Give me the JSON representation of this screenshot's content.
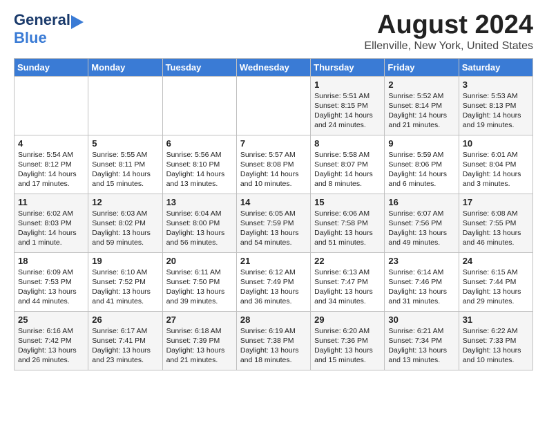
{
  "header": {
    "logo": {
      "line1": "General",
      "line2": "Blue"
    },
    "title": "August 2024",
    "location": "Ellenville, New York, United States"
  },
  "weekdays": [
    "Sunday",
    "Monday",
    "Tuesday",
    "Wednesday",
    "Thursday",
    "Friday",
    "Saturday"
  ],
  "weeks": [
    [
      {
        "day": "",
        "content": ""
      },
      {
        "day": "",
        "content": ""
      },
      {
        "day": "",
        "content": ""
      },
      {
        "day": "",
        "content": ""
      },
      {
        "day": "1",
        "content": "Sunrise: 5:51 AM\nSunset: 8:15 PM\nDaylight: 14 hours\nand 24 minutes."
      },
      {
        "day": "2",
        "content": "Sunrise: 5:52 AM\nSunset: 8:14 PM\nDaylight: 14 hours\nand 21 minutes."
      },
      {
        "day": "3",
        "content": "Sunrise: 5:53 AM\nSunset: 8:13 PM\nDaylight: 14 hours\nand 19 minutes."
      }
    ],
    [
      {
        "day": "4",
        "content": "Sunrise: 5:54 AM\nSunset: 8:12 PM\nDaylight: 14 hours\nand 17 minutes."
      },
      {
        "day": "5",
        "content": "Sunrise: 5:55 AM\nSunset: 8:11 PM\nDaylight: 14 hours\nand 15 minutes."
      },
      {
        "day": "6",
        "content": "Sunrise: 5:56 AM\nSunset: 8:10 PM\nDaylight: 14 hours\nand 13 minutes."
      },
      {
        "day": "7",
        "content": "Sunrise: 5:57 AM\nSunset: 8:08 PM\nDaylight: 14 hours\nand 10 minutes."
      },
      {
        "day": "8",
        "content": "Sunrise: 5:58 AM\nSunset: 8:07 PM\nDaylight: 14 hours\nand 8 minutes."
      },
      {
        "day": "9",
        "content": "Sunrise: 5:59 AM\nSunset: 8:06 PM\nDaylight: 14 hours\nand 6 minutes."
      },
      {
        "day": "10",
        "content": "Sunrise: 6:01 AM\nSunset: 8:04 PM\nDaylight: 14 hours\nand 3 minutes."
      }
    ],
    [
      {
        "day": "11",
        "content": "Sunrise: 6:02 AM\nSunset: 8:03 PM\nDaylight: 14 hours\nand 1 minute."
      },
      {
        "day": "12",
        "content": "Sunrise: 6:03 AM\nSunset: 8:02 PM\nDaylight: 13 hours\nand 59 minutes."
      },
      {
        "day": "13",
        "content": "Sunrise: 6:04 AM\nSunset: 8:00 PM\nDaylight: 13 hours\nand 56 minutes."
      },
      {
        "day": "14",
        "content": "Sunrise: 6:05 AM\nSunset: 7:59 PM\nDaylight: 13 hours\nand 54 minutes."
      },
      {
        "day": "15",
        "content": "Sunrise: 6:06 AM\nSunset: 7:58 PM\nDaylight: 13 hours\nand 51 minutes."
      },
      {
        "day": "16",
        "content": "Sunrise: 6:07 AM\nSunset: 7:56 PM\nDaylight: 13 hours\nand 49 minutes."
      },
      {
        "day": "17",
        "content": "Sunrise: 6:08 AM\nSunset: 7:55 PM\nDaylight: 13 hours\nand 46 minutes."
      }
    ],
    [
      {
        "day": "18",
        "content": "Sunrise: 6:09 AM\nSunset: 7:53 PM\nDaylight: 13 hours\nand 44 minutes."
      },
      {
        "day": "19",
        "content": "Sunrise: 6:10 AM\nSunset: 7:52 PM\nDaylight: 13 hours\nand 41 minutes."
      },
      {
        "day": "20",
        "content": "Sunrise: 6:11 AM\nSunset: 7:50 PM\nDaylight: 13 hours\nand 39 minutes."
      },
      {
        "day": "21",
        "content": "Sunrise: 6:12 AM\nSunset: 7:49 PM\nDaylight: 13 hours\nand 36 minutes."
      },
      {
        "day": "22",
        "content": "Sunrise: 6:13 AM\nSunset: 7:47 PM\nDaylight: 13 hours\nand 34 minutes."
      },
      {
        "day": "23",
        "content": "Sunrise: 6:14 AM\nSunset: 7:46 PM\nDaylight: 13 hours\nand 31 minutes."
      },
      {
        "day": "24",
        "content": "Sunrise: 6:15 AM\nSunset: 7:44 PM\nDaylight: 13 hours\nand 29 minutes."
      }
    ],
    [
      {
        "day": "25",
        "content": "Sunrise: 6:16 AM\nSunset: 7:42 PM\nDaylight: 13 hours\nand 26 minutes."
      },
      {
        "day": "26",
        "content": "Sunrise: 6:17 AM\nSunset: 7:41 PM\nDaylight: 13 hours\nand 23 minutes."
      },
      {
        "day": "27",
        "content": "Sunrise: 6:18 AM\nSunset: 7:39 PM\nDaylight: 13 hours\nand 21 minutes."
      },
      {
        "day": "28",
        "content": "Sunrise: 6:19 AM\nSunset: 7:38 PM\nDaylight: 13 hours\nand 18 minutes."
      },
      {
        "day": "29",
        "content": "Sunrise: 6:20 AM\nSunset: 7:36 PM\nDaylight: 13 hours\nand 15 minutes."
      },
      {
        "day": "30",
        "content": "Sunrise: 6:21 AM\nSunset: 7:34 PM\nDaylight: 13 hours\nand 13 minutes."
      },
      {
        "day": "31",
        "content": "Sunrise: 6:22 AM\nSunset: 7:33 PM\nDaylight: 13 hours\nand 10 minutes."
      }
    ]
  ]
}
